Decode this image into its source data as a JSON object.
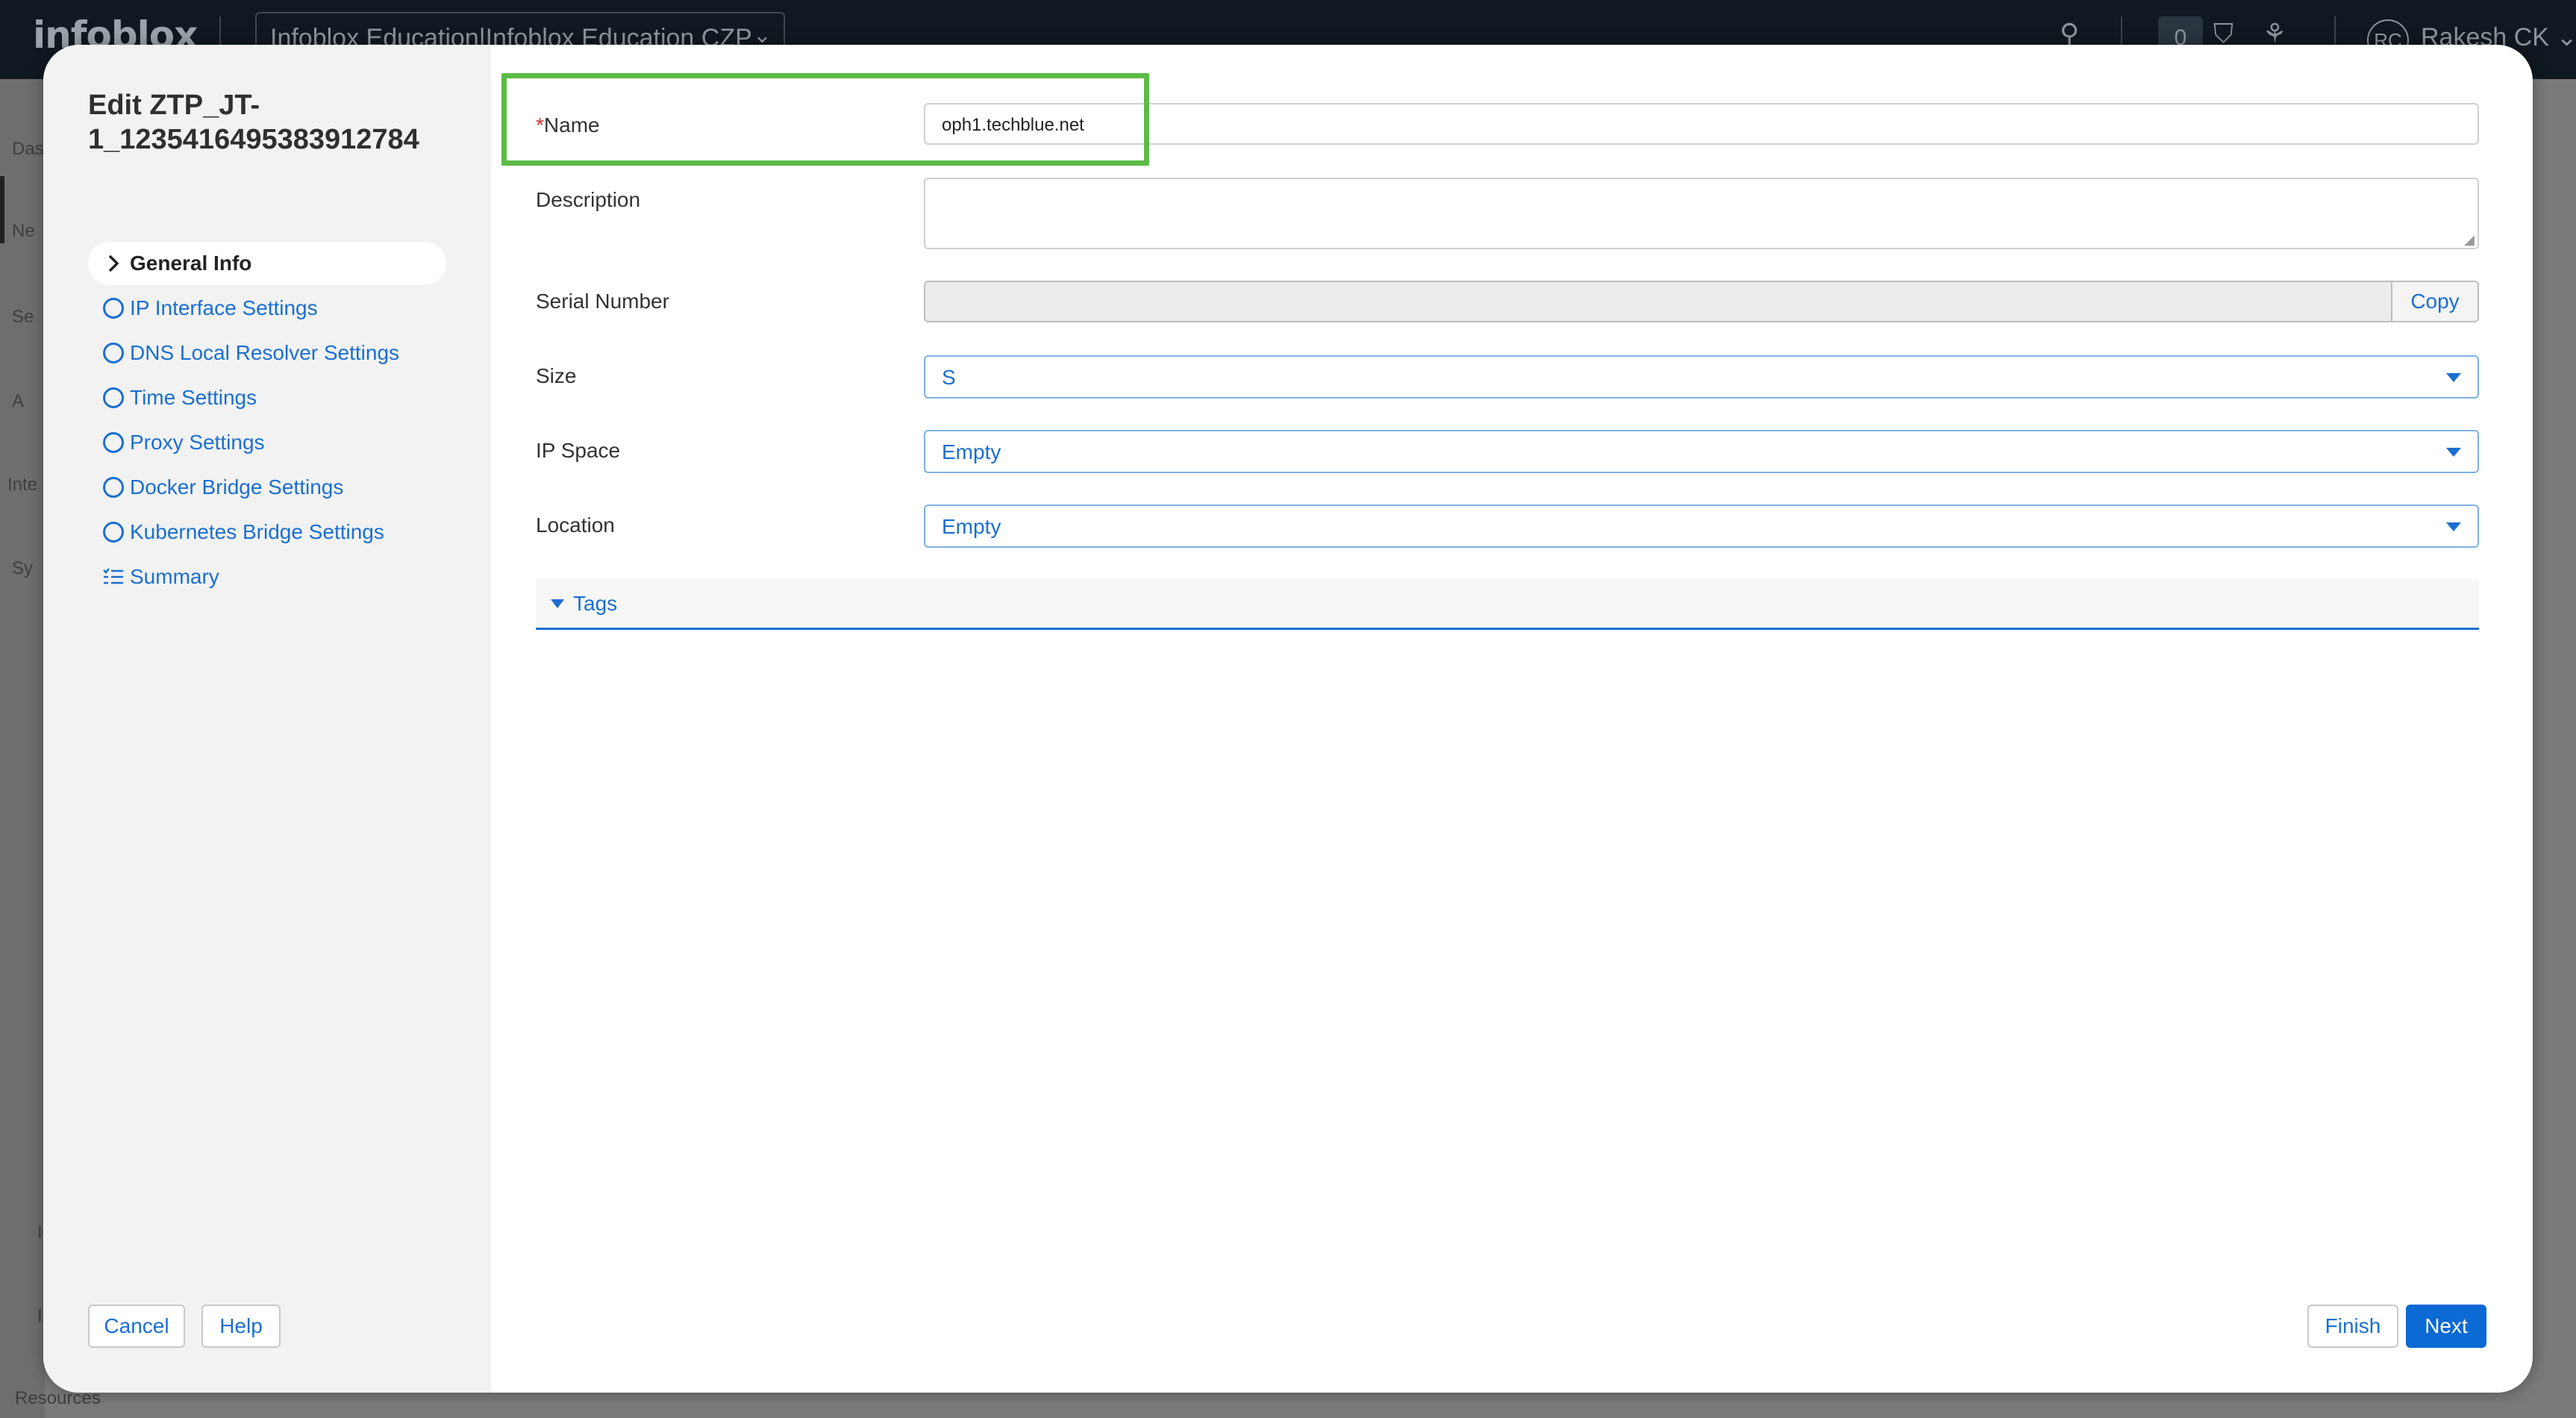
{
  "app": {
    "logo": "infoblox",
    "org_selector": "Infoblox Education|Infoblox Education CZP",
    "notification_count": "0",
    "user_initials": "RC",
    "user_name": "Rakesh CK"
  },
  "background_sidebar": {
    "items": [
      "Das",
      "Ne",
      "Se",
      "A",
      "Inte",
      "Sy",
      "I",
      "I"
    ],
    "footer": "Resources"
  },
  "modal": {
    "title": "Edit ZTP_JT-1_1235416495383912784",
    "steps": [
      {
        "label": "General Info",
        "icon": "chevron-right-icon",
        "active": true
      },
      {
        "label": "IP Interface Settings",
        "icon": "circle-icon",
        "active": false
      },
      {
        "label": "DNS Local Resolver Settings",
        "icon": "circle-icon",
        "active": false
      },
      {
        "label": "Time Settings",
        "icon": "circle-icon",
        "active": false
      },
      {
        "label": "Proxy Settings",
        "icon": "circle-icon",
        "active": false
      },
      {
        "label": "Docker Bridge Settings",
        "icon": "circle-icon",
        "active": false
      },
      {
        "label": "Kubernetes Bridge Settings",
        "icon": "circle-icon",
        "active": false
      },
      {
        "label": "Summary",
        "icon": "list-icon",
        "active": false
      }
    ],
    "form": {
      "name_required_marker": "*",
      "name_label": "Name",
      "name_value": "oph1.techblue.net",
      "description_label": "Description",
      "description_value": "",
      "serial_label": "Serial Number",
      "serial_value": "",
      "copy_label": "Copy",
      "size_label": "Size",
      "size_value": "S",
      "ip_space_label": "IP Space",
      "ip_space_value": "Empty",
      "location_label": "Location",
      "location_value": "Empty",
      "tags_label": "Tags"
    },
    "buttons": {
      "cancel": "Cancel",
      "help": "Help",
      "finish": "Finish",
      "next": "Next"
    }
  },
  "colors": {
    "accent": "#1a6fd1",
    "primary_button": "#0b6ad4",
    "highlight": "#5cbb46",
    "required": "#d32f2f"
  }
}
